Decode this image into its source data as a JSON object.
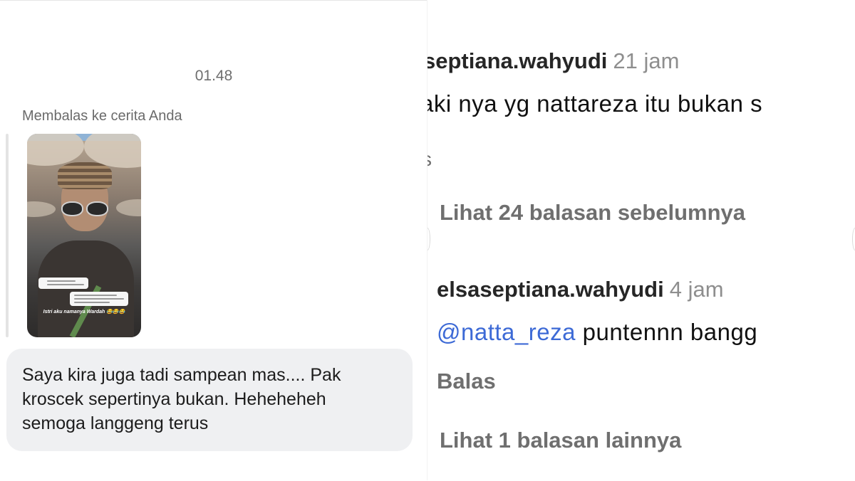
{
  "dm": {
    "timestamp": "01.48",
    "reply_label": "Membalas ke cerita Anda",
    "story": {
      "caption": "Istri aku namanya Wardah 😂😂😂"
    },
    "message_lines": [
      "Saya kira juga tadi sampean mas.... Pak",
      "kroscek sepertinya bukan. Heheheheh",
      "semoga langgeng terus"
    ]
  },
  "comments": {
    "first": {
      "username": "septiana.wahyudi",
      "time": "21 jam",
      "text": "aki nya yg nattareza itu bukan s",
      "action_fragment": "s"
    },
    "view_previous": "Lihat 24 balasan sebelumnya",
    "second": {
      "username": "elsaseptiana.wahyudi",
      "time": "4 jam",
      "mention": "@natta_reza",
      "text": " puntennn bangg",
      "reply_label": "Balas"
    },
    "view_more": "Lihat 1 balasan lainnya"
  },
  "colors": {
    "bubble_bg": "#eff0f2",
    "mention": "#3d6ad6",
    "secondary_text": "#8e8e8e"
  }
}
